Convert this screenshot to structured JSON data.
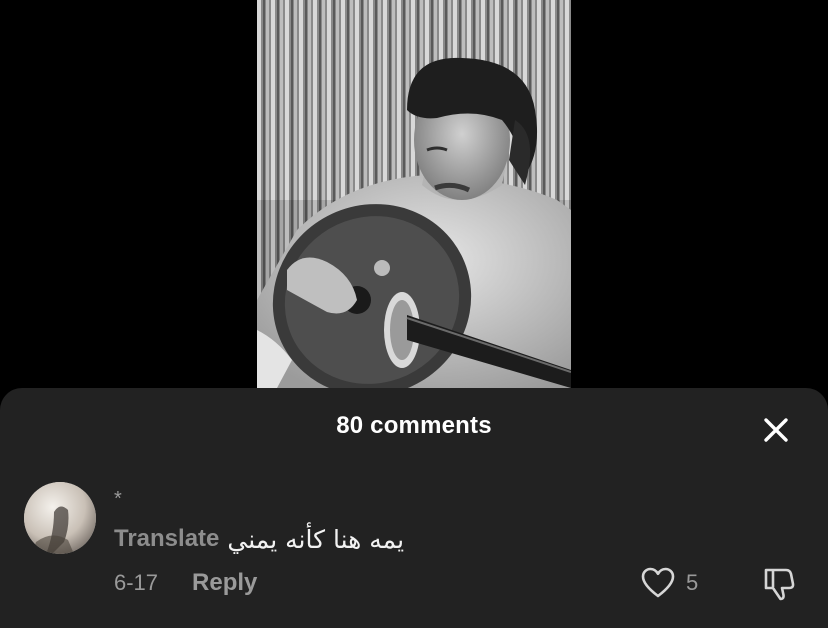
{
  "sheet": {
    "title": "80 comments",
    "close_icon": "close-icon"
  },
  "comment": {
    "username": "*",
    "translate_label": "Translate",
    "text": "يمه هنا كأنه يمني",
    "date": "6-17",
    "reply_label": "Reply",
    "like_count": "5",
    "like_icon": "heart-outline-icon",
    "dislike_icon": "thumbs-down-icon"
  },
  "colors": {
    "background": "#000000",
    "sheet_background": "#222222",
    "primary_text": "#ffffff",
    "secondary_text": "#9a9a9a"
  }
}
